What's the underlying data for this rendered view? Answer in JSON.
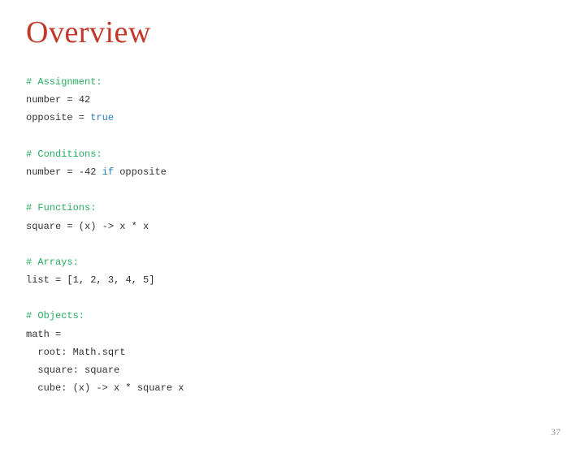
{
  "title": "Overview",
  "page_number": "37",
  "code": {
    "c_assign": "# Assignment:",
    "l_num_1": "number",
    "l_num_eq": " = ",
    "l_num_42": "42",
    "l_opp_1": "opposite = ",
    "l_opp_true": "true",
    "c_cond": "# Conditions:",
    "l_cond_1": "number = -",
    "l_cond_42": "42",
    "l_cond_sp": " ",
    "l_cond_if": "if",
    "l_cond_2": " opposite",
    "c_func": "# Functions:",
    "l_func": "square = (x) -> x * x",
    "c_arr": "# Arrays:",
    "l_arr_1": "list = [",
    "l_arr_n1": "1",
    "l_arr_s1": ", ",
    "l_arr_n2": "2",
    "l_arr_s2": ", ",
    "l_arr_n3": "3",
    "l_arr_s3": ", ",
    "l_arr_n4": "4",
    "l_arr_s4": ", ",
    "l_arr_n5": "5",
    "l_arr_end": "]",
    "c_obj": "# Objects:",
    "l_obj1": "math =",
    "l_obj2": "  root: Math.sqrt",
    "l_obj3": "  square: square",
    "l_obj4": "  cube: (x) -> x * square x",
    "blank": " "
  }
}
